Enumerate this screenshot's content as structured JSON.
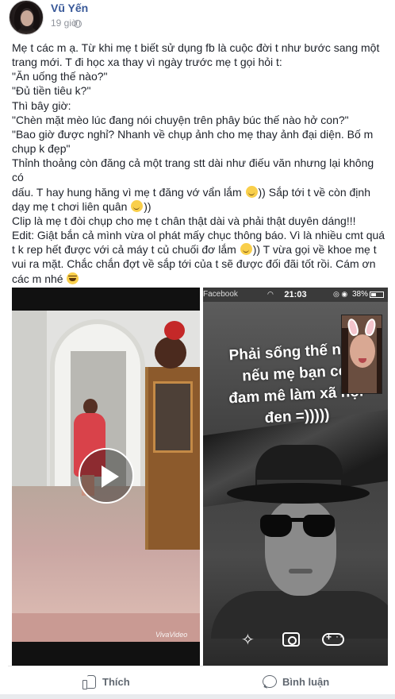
{
  "post": {
    "author": "Vũ Yến",
    "time": "19 giờ",
    "lines": [
      "Mẹ t các m ạ. Từ khi mẹ t biết sử dụng fb là cuộc đời t như bước sang một",
      "trang mới. T đi học xa thay vì ngày trước mẹ t gọi hỏi t:",
      "\"Ăn uống thế nào?\"",
      "\"Đủ tiền tiêu k?\"",
      "Thì bây giờ:",
      "\"Chèn mặt mèo lúc đang nói chuyện trên phây búc thế nào hở con?\"",
      "\"Bao giờ được nghỉ? Nhanh về chụp ảnh cho mẹ thay ảnh đại diện. Bố m",
      "chụp k đẹp\"",
      "Thỉnh thoảng còn đăng cả một trang stt dài như điếu văn nhưng lại không có",
      "dấu. T hay hung hăng vì mẹ t đăng vớ vẩn lắm",
      "dạy mẹ t chơi liên quân",
      "Clip là mẹ t đòi chụp cho mẹ t chân thật dài và phải thật duyên dáng!!!",
      "Edit: Giật bắn cả mình vừa ol phát mấy chục thông báo. Vì là nhiều cmt quá",
      "t k rep hết được với cả máy t củ chuối đơ lắm",
      "vui ra mặt. Chắc chắn đợt về sắp tới của t sẽ được đối đãi tốt rồi. Cám ơn",
      "các m nhé"
    ],
    "line9_suffix": ")) Sắp tới t về còn định",
    "line10_suffix": "))",
    "line13_suffix": ")) T vừa gọi về khoe mẹ t"
  },
  "video": {
    "watermark": "VivaVideo"
  },
  "phone": {
    "carrier": "Facebook",
    "time": "21:03",
    "battery": "38%",
    "caption_lines": [
      "Phải sống thế nào",
      "nếu mẹ bạn có",
      "đam mê làm xã hội",
      "đen =)))))"
    ]
  },
  "actions": {
    "like": "Thích",
    "comment": "Bình luận"
  },
  "colors": {
    "author": "#385898",
    "meta": "#90949c",
    "action_text": "#606770"
  },
  "icons": {
    "like": "thumbs-up-icon",
    "comment": "speech-bubble-icon",
    "play": "play-icon",
    "sparkle": "sparkle-icon",
    "camera": "camera-icon",
    "game": "gamepad-icon"
  }
}
